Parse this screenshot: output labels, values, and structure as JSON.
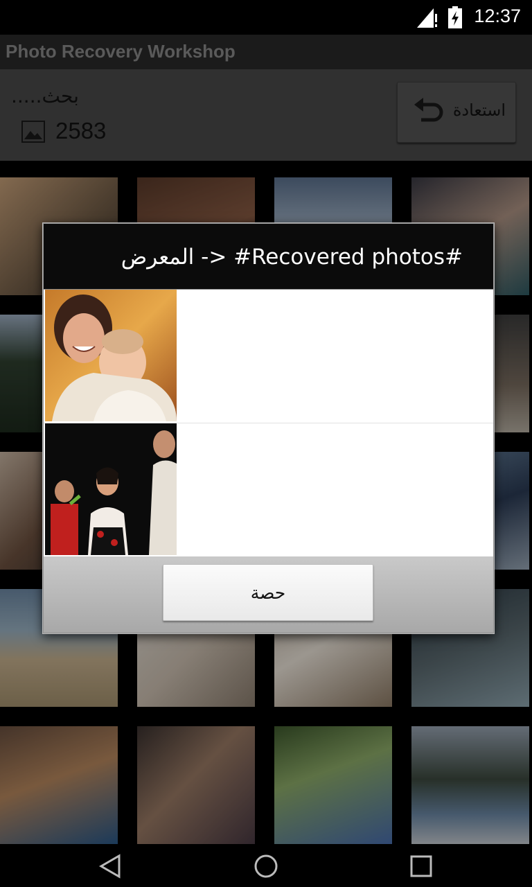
{
  "status_bar": {
    "time": "12:37"
  },
  "app_bar": {
    "title": "Photo Recovery Workshop"
  },
  "header": {
    "search_status": "بحث.....",
    "photo_count": "2583",
    "restore_label": "استعادة"
  },
  "dialog": {
    "title": "المعرض -> #Recovered photos#",
    "items": [
      {
        "icon": "photo-thumbnail-mother-baby"
      },
      {
        "icon": "photo-thumbnail-performers"
      }
    ],
    "share_label": "حصة"
  },
  "nav": {
    "icons": [
      "back-icon",
      "home-icon",
      "recents-icon"
    ]
  }
}
